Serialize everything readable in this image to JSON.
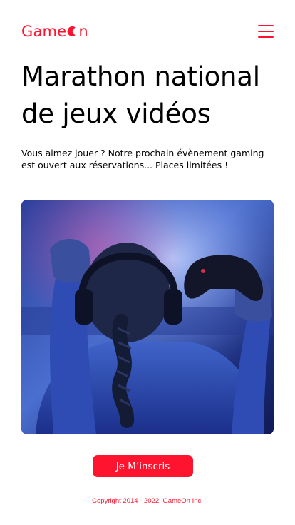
{
  "brand": {
    "name_part1": "Game",
    "name_part2": "n",
    "accent_color": "#FE142F"
  },
  "header": {
    "menu_icon": "hamburger-menu-icon"
  },
  "hero": {
    "title": "Marathon national de jeux vidéos",
    "subtitle": "Vous aimez jouer ? Notre prochain évènement gaming est ouvert aux réservations... Places limitées !",
    "image_subject": "gamer-with-headphones-holding-controller"
  },
  "cta": {
    "label": "Je M’inscris"
  },
  "footer": {
    "copyright": "Copyright 2014 - 2022, GameOn Inc."
  }
}
